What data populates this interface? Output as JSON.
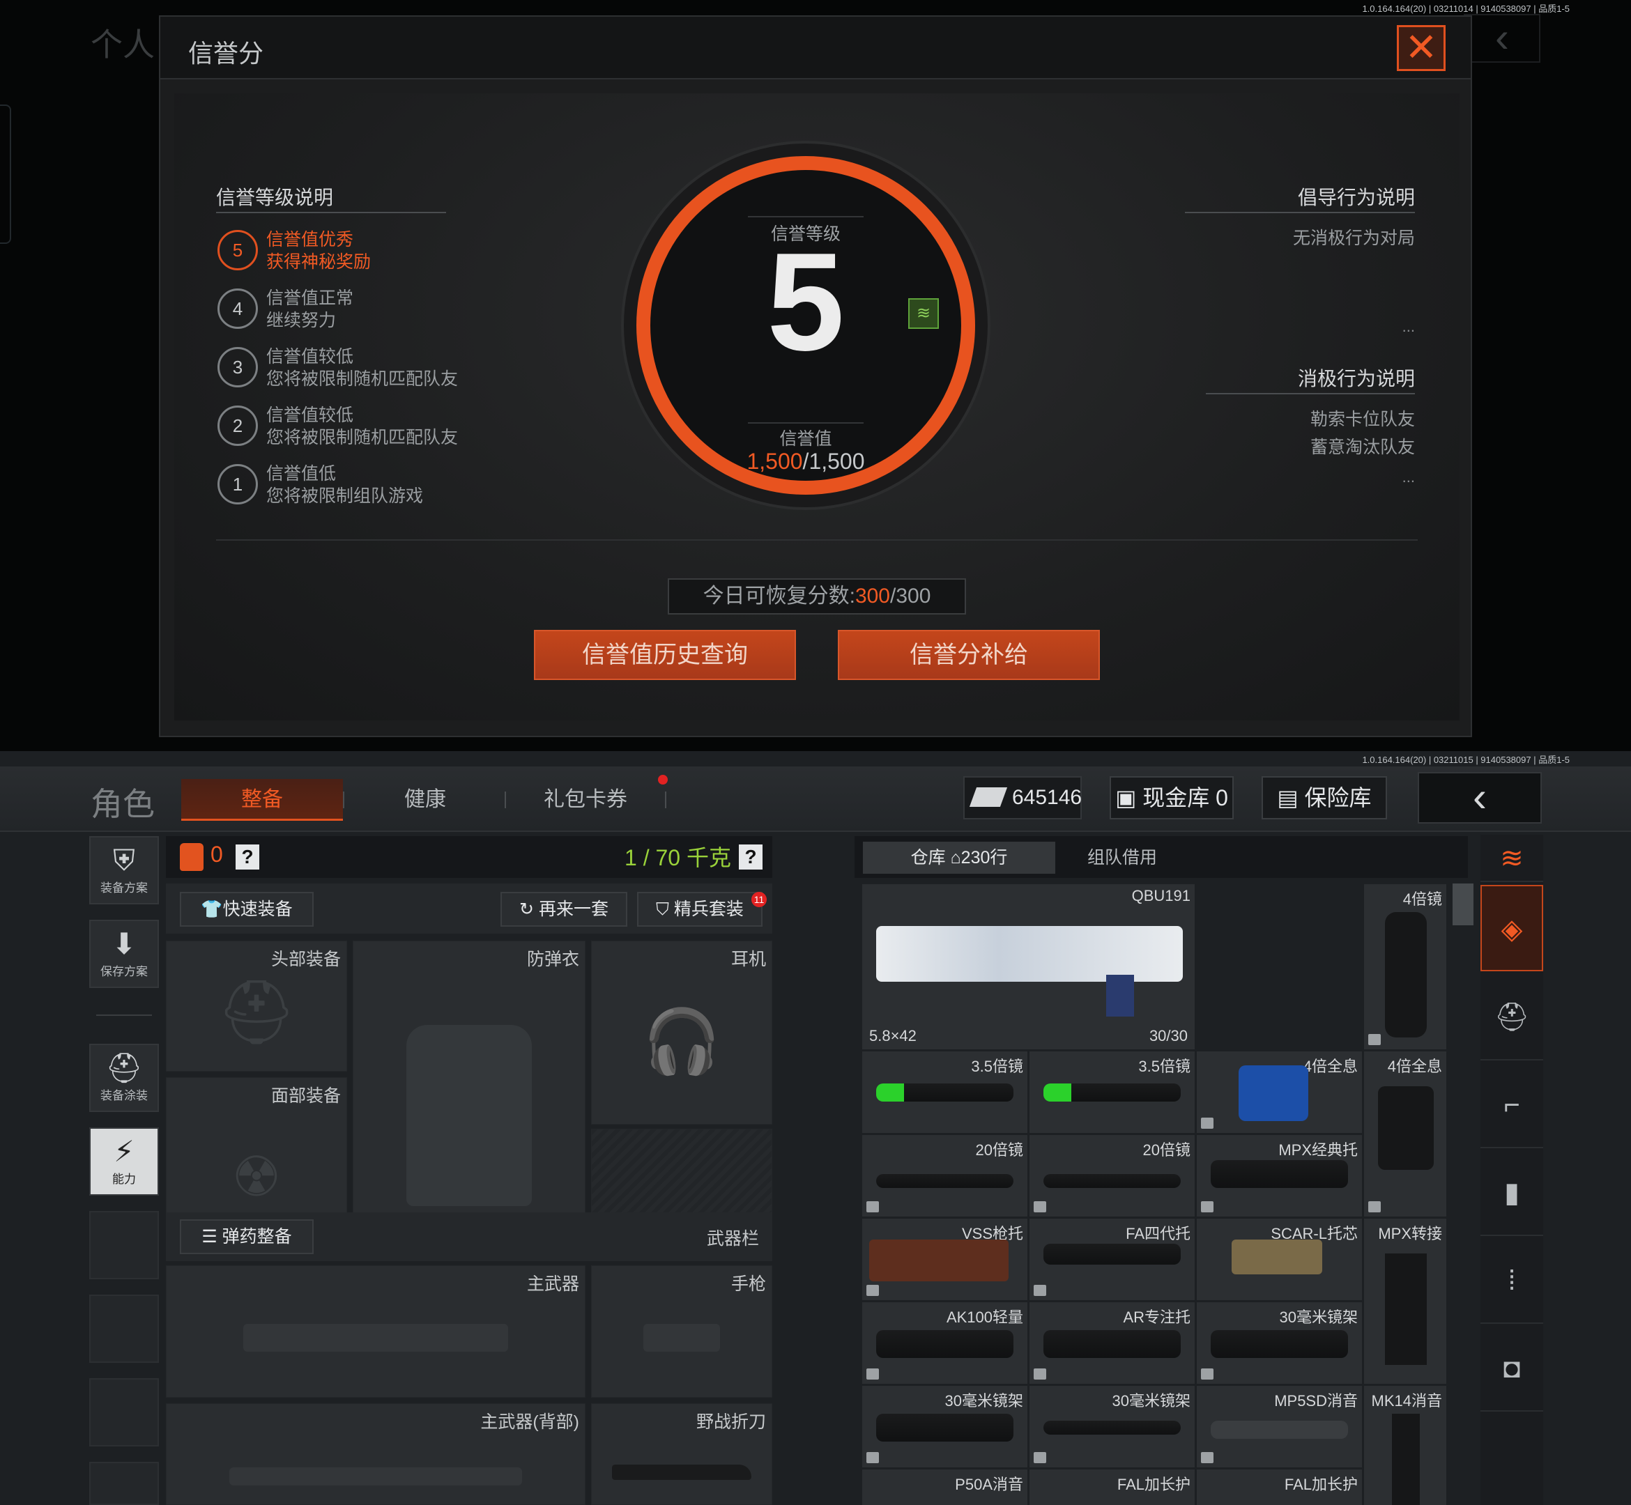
{
  "top": {
    "version": "1.0.164.164(20) | 03211014 | 9140538097 | 品质1-5",
    "bg_title": "个人",
    "title": "信誉分",
    "close_icon": "close-icon",
    "levels_title": "信誉等级说明",
    "levels": [
      {
        "num": "5",
        "line1": "信誉值优秀",
        "line2": "获得神秘奖励",
        "active": true
      },
      {
        "num": "4",
        "line1": "信誉值正常",
        "line2": "继续努力",
        "active": false
      },
      {
        "num": "3",
        "line1": "信誉值较低",
        "line2": "您将被限制随机匹配队友",
        "active": false
      },
      {
        "num": "2",
        "line1": "信誉值较低",
        "line2": "您将被限制随机匹配队友",
        "active": false
      },
      {
        "num": "1",
        "line1": "信誉值低",
        "line2": "您将被限制组队游戏",
        "active": false
      }
    ],
    "ring": {
      "level_label": "信誉等级",
      "level": "5",
      "value_label": "信誉值",
      "value_current": "1,500",
      "value_max": "/1,500"
    },
    "positive_title": "倡导行为说明",
    "positive_items": [
      "无消极行为对局"
    ],
    "negative_title": "消极行为说明",
    "negative_items": [
      "勒索卡位队友",
      "蓄意淘汰队友"
    ],
    "more": "...",
    "recover_label": "今日可恢复分数:",
    "recover_current": "300",
    "recover_max": "/300",
    "btn_history": "信誉值历史查询",
    "btn_supply": "信誉分补给"
  },
  "bottom": {
    "version": "1.0.164.164(20) | 03211015 | 9140538097 | 品质1-5",
    "role": "角色",
    "tabs": [
      "整备",
      "健康",
      "礼包卡券"
    ],
    "money": "645146",
    "cash_vault": "现金库 0",
    "safe_vault": "保险库",
    "left_nav": [
      "装备方案",
      "保存方案",
      "装备涂装",
      "能力"
    ],
    "load_count": "0",
    "weight": "1 / 70 千克",
    "help": "?",
    "quick_equip": "快速装备",
    "again": "再来一套",
    "elite": "精兵套装",
    "elite_badge": "11",
    "slots": {
      "head": "头部装备",
      "armor": "防弹衣",
      "headset": "耳机",
      "face": "面部装备",
      "primary": "主武器",
      "pistol": "手枪",
      "primary_back": "主武器(背部)",
      "knife": "野战折刀"
    },
    "ammo": "弹药整备",
    "weapon_bar": "武器栏",
    "wh_tab": "仓库",
    "wh_rows": "230行",
    "team_borrow": "组队借用",
    "big_item": {
      "name": "QBU191",
      "caliber": "5.8×42",
      "ammo": "30/30"
    },
    "items": [
      "4倍镜",
      "3.5倍镜",
      "3.5倍镜",
      "4倍全息",
      "4倍全息",
      "20倍镜",
      "20倍镜",
      "MPX经典托",
      "VSS枪托",
      "FA四代托",
      "SCAR-L托芯",
      "MPX转接",
      "AK100轻量",
      "AR专注托",
      "30毫米镜架",
      "30毫米镜架",
      "30毫米镜架",
      "MP5SD消音",
      "MK14消音",
      "P50A消音",
      "FAL加长护",
      "FAL加长护"
    ]
  }
}
